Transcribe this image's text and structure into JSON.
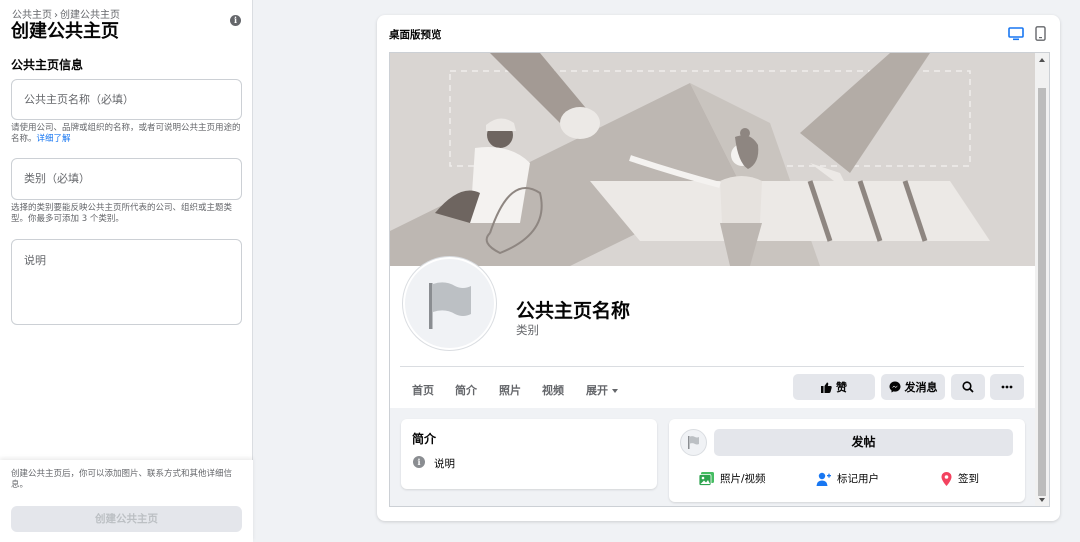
{
  "breadcrumb": {
    "items": [
      "公共主页",
      "创建公共主页"
    ],
    "separator": "›"
  },
  "page_title": "创建公共主页",
  "section_title": "公共主页信息",
  "form": {
    "name_placeholder": "公共主页名称（必填）",
    "name_help": "请使用公司、品牌或组织的名称，或者可说明公共主页用途的名称。",
    "name_help_link": "详细了解",
    "category_placeholder": "类别（必填）",
    "category_help": "选择的类别要能反映公共主页所代表的公司、组织或主题类型。你最多可添加 3 个类别。",
    "description_placeholder": "说明"
  },
  "footer": {
    "note": "创建公共主页后，你可以添加图片、联系方式和其他详细信息。",
    "create_button": "创建公共主页"
  },
  "preview": {
    "title": "桌面版预览",
    "page_name": "公共主页名称",
    "category": "类别",
    "tabs": [
      "首页",
      "简介",
      "照片",
      "视频",
      "展开"
    ],
    "like_label": "赞",
    "message_label": "发消息",
    "intro_title": "简介",
    "intro_desc": "说明",
    "post_button": "发帖",
    "post_actions": [
      "照片/视频",
      "标记用户",
      "签到"
    ]
  },
  "colors": {
    "accent": "#1877f2",
    "cover_bg": "#d9d5d2",
    "page_bg": "#f0f2f5"
  },
  "icons": [
    "info-icon",
    "desktop-icon",
    "mobile-icon",
    "flag-icon",
    "like-icon",
    "messenger-icon",
    "search-icon",
    "more-icon",
    "photo-icon",
    "tag-user-icon",
    "check-in-icon"
  ]
}
